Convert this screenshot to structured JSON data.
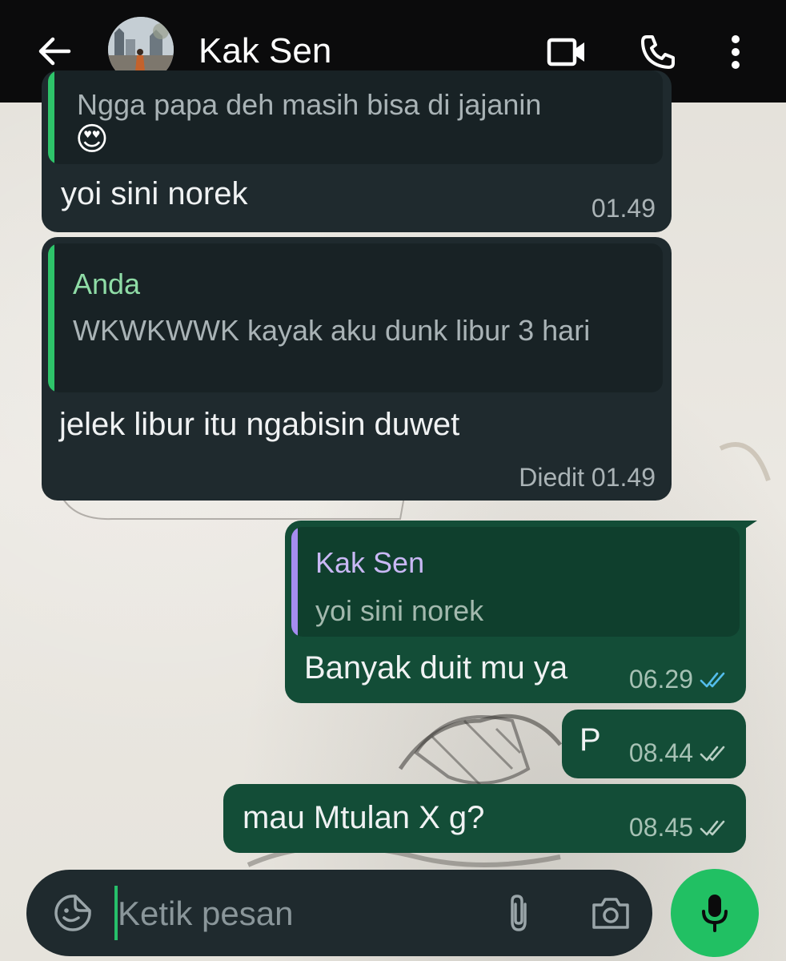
{
  "header": {
    "title": "Kak Sen",
    "icons": [
      "back-arrow-icon",
      "video-call-icon",
      "voice-call-icon",
      "more-options-icon"
    ]
  },
  "messages": [
    {
      "direction": "incoming",
      "quote": {
        "text": "Ngga papa deh masih bisa di jajanin",
        "emoji": "😍"
      },
      "text": "yoi sini norek",
      "time": "01.49"
    },
    {
      "direction": "incoming",
      "quote": {
        "name": "Anda",
        "text": "WKWKWWK kayak aku dunk libur 3 hari"
      },
      "text": "jelek libur itu ngabisin duwet",
      "time": "Diedit 01.49"
    },
    {
      "direction": "outgoing",
      "quote": {
        "name": "Kak Sen",
        "text": "yoi sini norek"
      },
      "text": "Banyak duit mu ya",
      "time": "06.29",
      "status": "read"
    },
    {
      "direction": "outgoing",
      "text": "P",
      "time": "08.44",
      "status": "delivered"
    },
    {
      "direction": "outgoing",
      "text": "mau Mtulan X g?",
      "time": "08.45",
      "status": "delivered"
    }
  ],
  "composer": {
    "placeholder": "Ketik pesan",
    "icons": [
      "sticker-icon",
      "attach-icon",
      "camera-icon",
      "mic-icon"
    ]
  },
  "colors": {
    "header_bg": "#0b0b0c",
    "incoming_bubble": "#1f2a2e",
    "outgoing_bubble": "#134d37",
    "accent_green": "#21c063",
    "quote_name_anda": "#8fdca6",
    "quote_name_kaksen": "#c9b8f5",
    "read_ticks": "#53bdeb"
  }
}
